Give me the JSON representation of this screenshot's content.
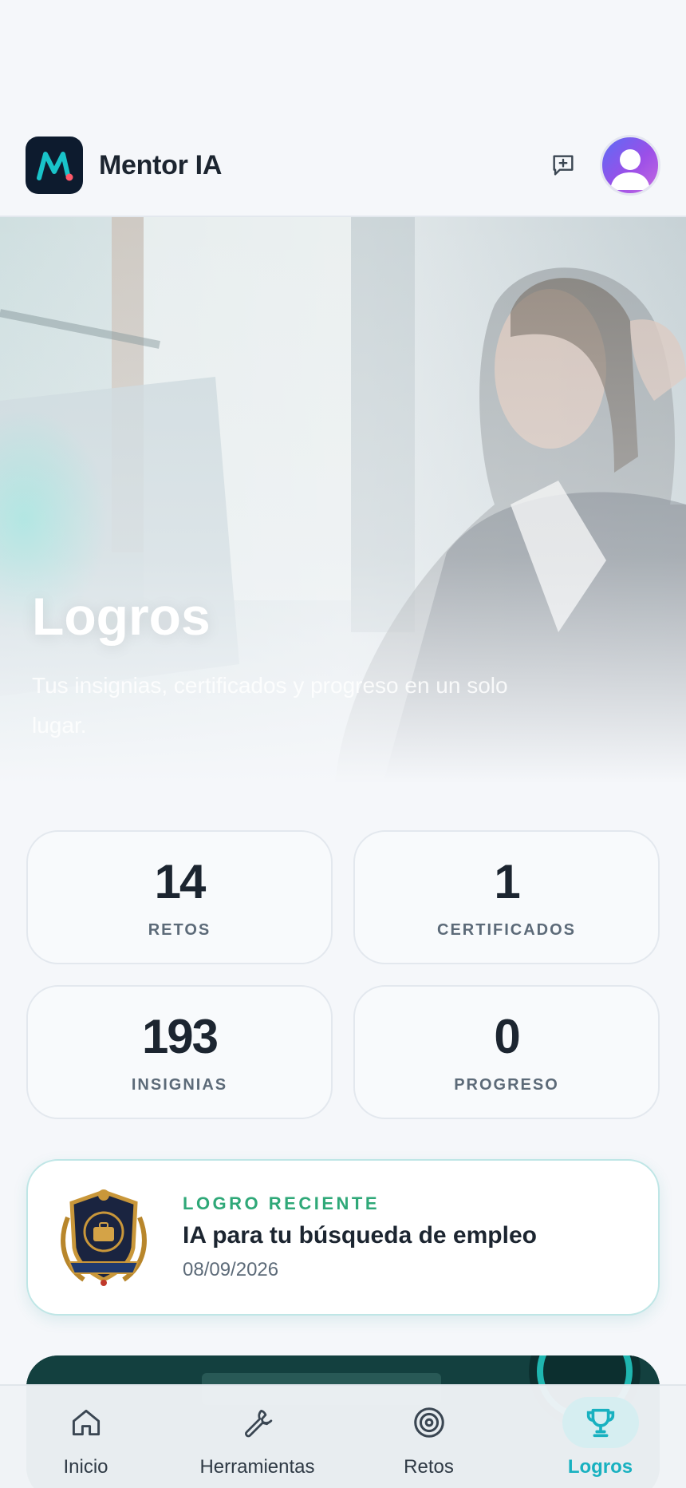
{
  "header": {
    "app_title": "Mentor IA",
    "logo_letter": "M",
    "new_chat_icon": "message-plus-icon",
    "avatar_icon": "user-icon"
  },
  "hero": {
    "title": "Logros",
    "subtitle": "Tus insignias, certificados y progreso en un solo lugar."
  },
  "stats": [
    {
      "value": "14",
      "label": "RETOS"
    },
    {
      "value": "1",
      "label": "CERTIFICADOS"
    },
    {
      "value": "193",
      "label": "INSIGNIAS"
    },
    {
      "value": "0",
      "label": "PROGRESO"
    }
  ],
  "recent": {
    "eyebrow": "LOGRO RECIENTE",
    "title": "IA para tu búsqueda de empleo",
    "date": "08/09/2026",
    "badge_icon": "achievement-badge-icon"
  },
  "nav": [
    {
      "label": "Inicio",
      "icon": "home-icon",
      "active": false
    },
    {
      "label": "Herramientas",
      "icon": "wrench-icon",
      "active": false
    },
    {
      "label": "Retos",
      "icon": "target-icon",
      "active": false
    },
    {
      "label": "Logros",
      "icon": "trophy-icon",
      "active": true
    }
  ],
  "colors": {
    "accent": "#18b1c0",
    "eyebrow": "#2fa878",
    "text": "#1c2530",
    "muted": "#5c6a78",
    "background": "#f5f7fa"
  }
}
